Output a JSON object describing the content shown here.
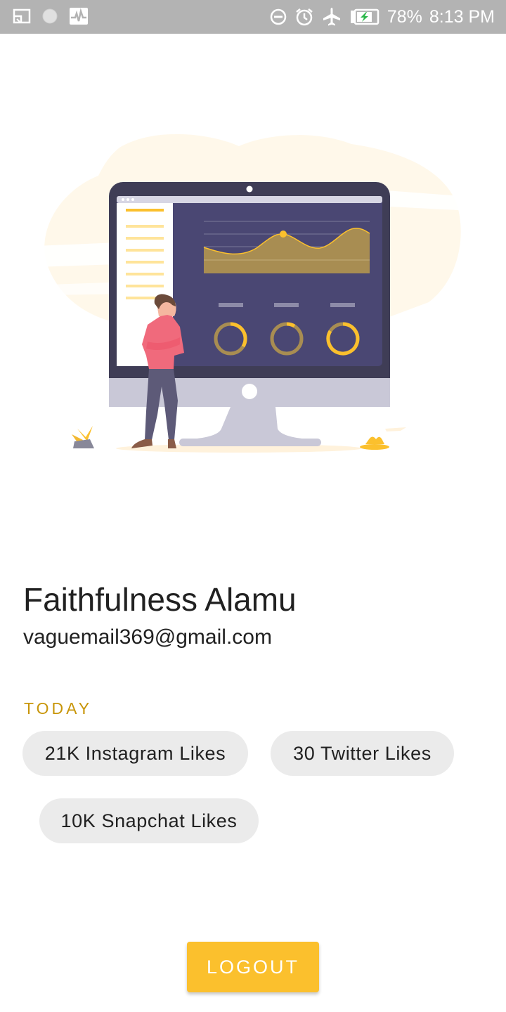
{
  "status_bar": {
    "battery_percent": "78%",
    "time": "8:13 PM",
    "left_icons": [
      "screen-cast-icon",
      "circle-notification-icon",
      "activity-monitor-icon"
    ],
    "right_icons": [
      "do-not-disturb-icon",
      "alarm-icon",
      "airplane-mode-icon",
      "battery-charging-icon"
    ]
  },
  "colors": {
    "status_bar_bg": "#b3b3b3",
    "accent": "#fbc02d",
    "section_label": "#c8960a",
    "chip_bg": "#ebebeb",
    "monitor_screen": "#4a4773",
    "chart_fill": "#a88d52"
  },
  "illustration": {
    "name": "dashboard-monitor-illustration"
  },
  "profile": {
    "name": "Faithfulness Alamu",
    "email": "vaguemail369@gmail.com"
  },
  "today": {
    "label": "TODAY",
    "chips": [
      {
        "label": "21K Instagram Likes"
      },
      {
        "label": "30 Twitter Likes"
      },
      {
        "label": "10K Snapchat Likes"
      }
    ]
  },
  "actions": {
    "logout_label": "LOGOUT"
  }
}
